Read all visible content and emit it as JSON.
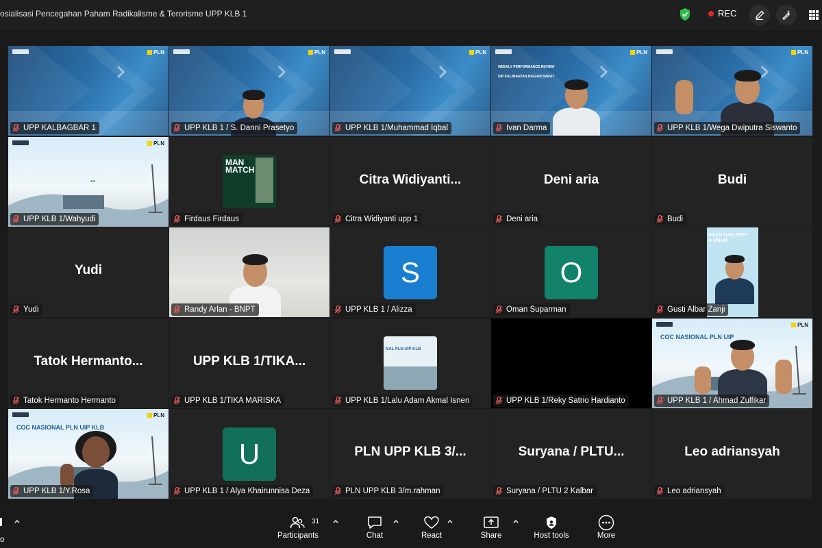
{
  "window": {
    "title": "osialisasi Pencegahan Paham Radikalisme & Terorisme UPP KLB 1",
    "rec_label": "REC"
  },
  "tiles": [
    {
      "name": "UPP KALBAGBAR 1",
      "type": "slide"
    },
    {
      "name": "UPP KLB 1 / S. Danni Prasetyo",
      "type": "slide-person"
    },
    {
      "name": "UPP KLB 1/Muhammad Iqbal",
      "type": "slide"
    },
    {
      "name": "Ivan Darma",
      "type": "slide-person",
      "slide_text": [
        "WEEKLY PERFORMANCE REVIEW",
        "UIP KALIMANTAN BAGIAN BARAT"
      ]
    },
    {
      "name": "UPP KLB 1/Wega Dwiputra Siswanto",
      "type": "slide-person"
    },
    {
      "name": "UPP KLB 1/Wahyudi",
      "type": "light-slide"
    },
    {
      "name": "Firdaus Firdaus",
      "type": "poster",
      "poster_text": "MAN MATCH"
    },
    {
      "name": "Citra Widiyanti upp 1",
      "type": "name",
      "display": "Citra  Widiyanti..."
    },
    {
      "name": "Deni aria",
      "type": "name",
      "display": "Deni aria"
    },
    {
      "name": "Budi",
      "type": "name",
      "display": "Budi"
    },
    {
      "name": "Yudi",
      "type": "name",
      "display": "Yudi"
    },
    {
      "name": "Randy Arlan - BNPT",
      "type": "room-person",
      "active": true
    },
    {
      "name": "UPP KLB 1 / Alizza",
      "type": "avatar",
      "initial": "S",
      "color": "#1a7fd1"
    },
    {
      "name": "Oman Suparman",
      "type": "avatar",
      "initial": "O",
      "color": "#12826a"
    },
    {
      "name": "Gusti Albar Zanji",
      "type": "gusti",
      "slide_text": "NAAN DAN SERT\nA UMUM"
    },
    {
      "name": "Tatok Hermanto Hermanto",
      "type": "name",
      "display": "Tatok  Hermanto..."
    },
    {
      "name": "UPP KLB 1/TIKA MARISKA",
      "type": "name",
      "display": "UPP  KLB 1/TIKA..."
    },
    {
      "name": "UPP KLB 1/Lalu Adam Akmal Isnen",
      "type": "small-slide",
      "slide_text": "NAL PLN UIP KLB"
    },
    {
      "name": "UPP KLB 1/Reky Satrio Hardianto",
      "type": "black"
    },
    {
      "name": "UPP KLB 1 / Ahmad Zulfikar",
      "type": "coc-person",
      "slide_text": "COC NASIONAL PLN UIP"
    },
    {
      "name": "UPP KLB 1/Y.Rosa",
      "type": "coc-person2",
      "slide_text": "COC NASIONAL PLN UIP KLB"
    },
    {
      "name": "UPP KLB 1 / Alya Khairunnisa Deza",
      "type": "avatar",
      "initial": "U",
      "color": "#12705a"
    },
    {
      "name": "PLN UPP KLB 3/m.rahman",
      "type": "name",
      "display": "PLN  UPP  KLB 3/..."
    },
    {
      "name": "Suryana / PLTU 2 Kalbar",
      "type": "name",
      "display": "Suryana  /  PLTU..."
    },
    {
      "name": "Leo adriansyah",
      "type": "name",
      "display": "Leo adriansyah"
    }
  ],
  "toolbar": {
    "participants_count": "31",
    "participants_label": "Participants",
    "chat_label": "Chat",
    "react_label": "React",
    "share_label": "Share",
    "host_tools_label": "Host tools",
    "more_label": "More",
    "left_partial_label": "o"
  },
  "brand": {
    "pln": "PLN",
    "danantara": "Danantara Indonesia"
  },
  "colors": {
    "accent_green": "#35c25a",
    "rec_red": "#e02828",
    "shield_green": "#2fbf4f"
  }
}
